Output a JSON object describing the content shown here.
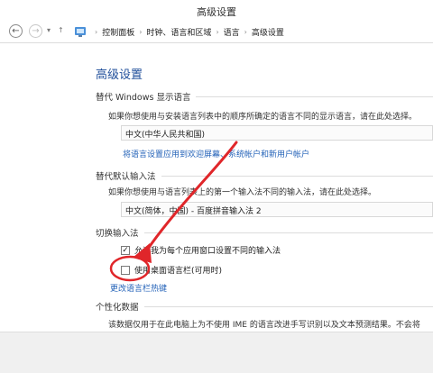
{
  "window": {
    "title": "高级设置"
  },
  "address": {
    "crumbs": [
      "控制面板",
      "时钟、语言和区域",
      "语言",
      "高级设置"
    ]
  },
  "page": {
    "title": "高级设置",
    "sections": {
      "display_lang": {
        "heading": "替代 Windows 显示语言",
        "description": "如果你想使用与安装语言列表中的顺序所确定的语言不同的显示语言，请在此处选择。",
        "select_value": "中文(中华人民共和国)",
        "link": "将语言设置应用到欢迎屏幕、系统帐户和新用户帐户"
      },
      "default_input": {
        "heading": "替代默认输入法",
        "description": "如果你想使用与语言列表上的第一个输入法不同的输入法，请在此处选择。",
        "select_value": "中文(简体，中国) - 百度拼音输入法 2"
      },
      "switch_input": {
        "heading": "切换输入法",
        "option1": "允许我为每个应用窗口设置不同的输入法",
        "option1_checked": true,
        "option2": "使用桌面语言栏(可用时)",
        "option2_checked": false,
        "link": "更改语言栏热键"
      },
      "personalization": {
        "heading": "个性化数据",
        "description": "该数据仅用于在此电脑上为不使用 IME 的语言改进手写识别以及文本预测结果。不会将"
      }
    }
  },
  "colors": {
    "title_blue": "#1f4e9a",
    "link_blue": "#2362b8",
    "annotation_red": "#e0262a"
  }
}
